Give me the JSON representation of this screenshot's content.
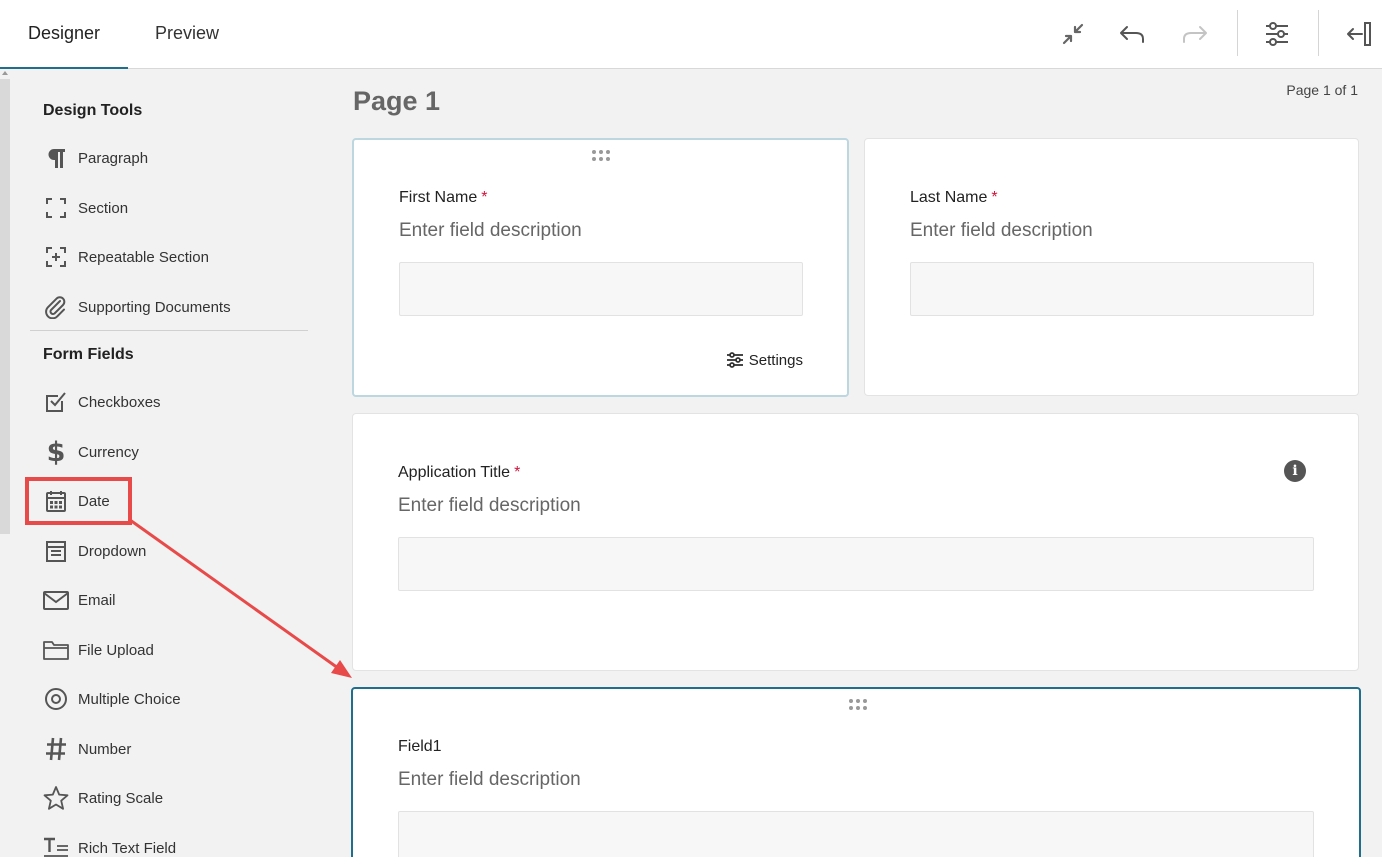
{
  "tabs": {
    "designer": "Designer",
    "preview": "Preview"
  },
  "toolbar": {
    "icons": [
      "collapse-icon",
      "undo-icon",
      "redo-icon",
      "settings-sliders-icon",
      "collapse-panel-icon"
    ]
  },
  "sidebar": {
    "design_tools_heading": "Design Tools",
    "design_tools": [
      {
        "label": "Paragraph",
        "icon": "paragraph-icon"
      },
      {
        "label": "Section",
        "icon": "section-icon"
      },
      {
        "label": "Repeatable Section",
        "icon": "repeatable-section-icon"
      },
      {
        "label": "Supporting Documents",
        "icon": "paperclip-icon"
      }
    ],
    "form_fields_heading": "Form Fields",
    "form_fields": [
      {
        "label": "Checkboxes",
        "icon": "checkbox-icon"
      },
      {
        "label": "Currency",
        "icon": "dollar-icon"
      },
      {
        "label": "Date",
        "icon": "calendar-icon"
      },
      {
        "label": "Dropdown",
        "icon": "dropdown-icon"
      },
      {
        "label": "Email",
        "icon": "envelope-icon"
      },
      {
        "label": "File Upload",
        "icon": "folder-icon"
      },
      {
        "label": "Multiple Choice",
        "icon": "radio-icon"
      },
      {
        "label": "Number",
        "icon": "hash-icon"
      },
      {
        "label": "Rating Scale",
        "icon": "star-icon"
      },
      {
        "label": "Rich Text Field",
        "icon": "rich-text-icon"
      }
    ]
  },
  "main": {
    "page_title": "Page 1",
    "page_count": "Page 1 of 1",
    "fields": {
      "first_name": {
        "label": "First Name",
        "required": "*",
        "description": "Enter field description",
        "settings_label": "Settings"
      },
      "last_name": {
        "label": "Last Name",
        "required": "*",
        "description": "Enter field description"
      },
      "application_title": {
        "label": "Application Title",
        "required": "*",
        "description": "Enter field description"
      },
      "field1": {
        "label": "Field1",
        "description": "Enter field description"
      }
    }
  },
  "colors": {
    "accent": "#1f6e8c",
    "required": "#d0143c",
    "highlight": "#e84a4a",
    "selected_border": "#bcd7e0"
  }
}
